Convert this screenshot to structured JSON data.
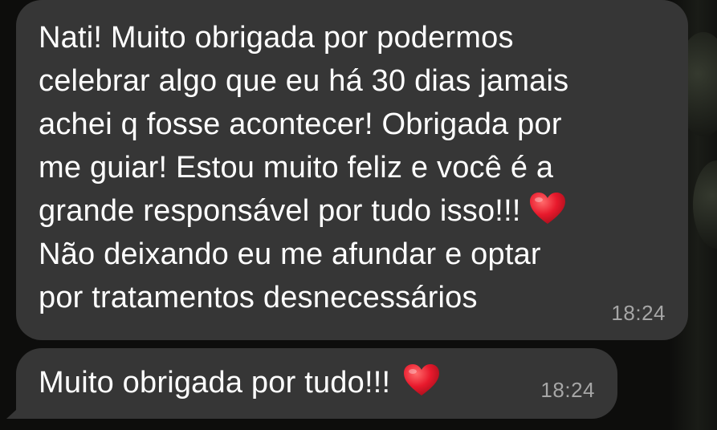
{
  "messages": [
    {
      "lines": [
        "Nati! Muito obrigada por podermos",
        "celebrar algo que eu há 30 dias jamais",
        "achei q fosse acontecer! Obrigada por",
        "me guiar! Estou muito feliz e você é a",
        "grande responsável por tudo isso!!!",
        "Não deixando eu me afundar e optar",
        "por tratamentos desnecessários"
      ],
      "heart_after_line": 4,
      "time": "18:24"
    },
    {
      "lines": [
        "Muito obrigada por tudo!!!"
      ],
      "heart_after_line": 0,
      "time": "18:24"
    }
  ],
  "icons": {
    "heart": "heart-emoji-icon"
  },
  "colors": {
    "background": "#0d0d0c",
    "bubble": "#363636",
    "text": "#ffffff",
    "timestamp": "#a6a6a6",
    "heart": "#e8192c"
  }
}
